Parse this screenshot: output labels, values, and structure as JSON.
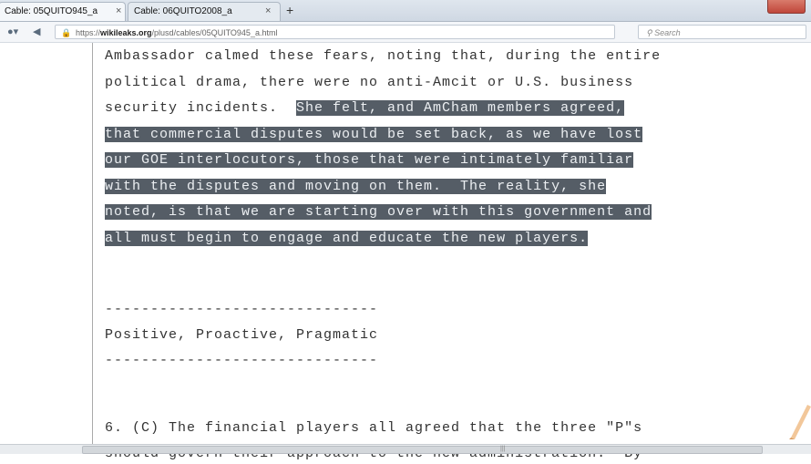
{
  "tabs": [
    {
      "title": "Cable: 05QUITO945_a",
      "close": "×"
    },
    {
      "title": "Cable: 06QUITO2008_a",
      "close": "×"
    }
  ],
  "new_tab": "+",
  "address": {
    "prefix": "https://",
    "domain": "wikileaks.org",
    "path": "/plusd/cables/05QUITO945_a.html",
    "search_placeholder": "Search"
  },
  "doc": {
    "lines": [
      {
        "pre": "Ambassador calmed these fears, noting that, during the entire",
        "hl": ""
      },
      {
        "pre": "political drama, there were no anti-Amcit or U.S. business",
        "hl": ""
      },
      {
        "pre": "security incidents.  ",
        "hl": "She felt, and AmCham members agreed,"
      },
      {
        "pre": "",
        "hl": "that commercial disputes would be set back, as we have lost"
      },
      {
        "pre": "",
        "hl": "our GOE interlocutors, those that were intimately familiar"
      },
      {
        "pre": "",
        "hl": "with the disputes and moving on them.  The reality, she"
      },
      {
        "pre": "",
        "hl": "noted, is that we are starting over with this government and"
      },
      {
        "pre": "",
        "hl": "all must begin to engage and educate the new players."
      },
      {
        "pre": "",
        "hl": ""
      },
      {
        "pre": "",
        "hl": ""
      },
      {
        "pre": "------------------------------",
        "hl": ""
      },
      {
        "pre": "Positive, Proactive, Pragmatic",
        "hl": ""
      },
      {
        "pre": "------------------------------",
        "hl": ""
      },
      {
        "pre": "",
        "hl": ""
      },
      {
        "pre": "",
        "hl": ""
      },
      {
        "pre": "6. (C) The financial players all agreed that the three \"P\"s",
        "hl": ""
      },
      {
        "pre": "should govern their approach to the new administration.  By",
        "hl": ""
      }
    ]
  }
}
